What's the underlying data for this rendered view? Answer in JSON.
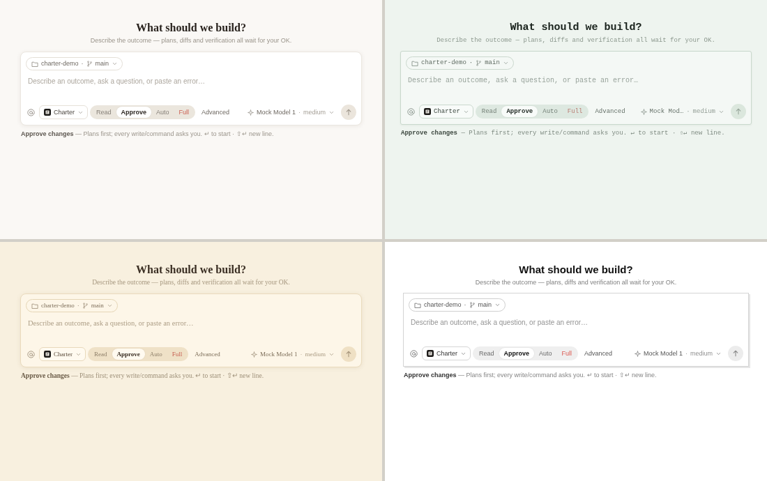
{
  "panels": [
    {
      "kind": "warm",
      "heading": "What should we build?",
      "subtitle": "Describe the outcome — plans, diffs and verification all wait for your OK.",
      "composer": {
        "repo": {
          "folder": "charter-demo",
          "separator": "·",
          "branch": "main"
        },
        "placeholder": "Describe an outcome, ask a question, or paste an error…",
        "agent": "Charter",
        "modes": [
          {
            "label": "Read",
            "selected": false,
            "kind": "normal"
          },
          {
            "label": "Approve",
            "selected": true,
            "kind": "normal"
          },
          {
            "label": "Auto",
            "selected": false,
            "kind": "normal"
          },
          {
            "label": "Full",
            "selected": false,
            "kind": "danger"
          }
        ],
        "advanced": "Advanced",
        "model": {
          "name": "Mock Model 1",
          "separator": "·",
          "effort": "medium"
        }
      },
      "hint": "**Approve changes** — Plans first; every write/command asks you. ↵ to start · ⇧↵ new line."
    },
    {
      "kind": "mint",
      "heading": "What should we build?",
      "subtitle": "Describe the outcome — plans, diffs and verification all wait for your OK.",
      "composer": {
        "repo": {
          "folder": "charter-demo",
          "separator": "·",
          "branch": "main"
        },
        "placeholder": "Describe an outcome, ask a question, or paste an error…",
        "agent": "Charter",
        "modes": [
          {
            "label": "Read",
            "selected": false,
            "kind": "normal"
          },
          {
            "label": "Approve",
            "selected": true,
            "kind": "normal"
          },
          {
            "label": "Auto",
            "selected": false,
            "kind": "normal"
          },
          {
            "label": "Full",
            "selected": false,
            "kind": "danger"
          }
        ],
        "advanced": "Advanced",
        "model": {
          "name": "Mock Mod…",
          "separator": "·",
          "effort": "medium"
        }
      },
      "hint": "**Approve changes** — Plans first; every write/command asks you. ↵ to start · ⇧↵ new line."
    },
    {
      "kind": "cream",
      "heading": "What should we build?",
      "subtitle": "Describe the outcome — plans, diffs and verification all wait for your OK.",
      "composer": {
        "repo": {
          "folder": "charter-demo",
          "separator": "·",
          "branch": "main"
        },
        "placeholder": "Describe an outcome, ask a question, or paste an error…",
        "agent": "Charter",
        "modes": [
          {
            "label": "Read",
            "selected": false,
            "kind": "normal"
          },
          {
            "label": "Approve",
            "selected": true,
            "kind": "normal"
          },
          {
            "label": "Auto",
            "selected": false,
            "kind": "normal"
          },
          {
            "label": "Full",
            "selected": false,
            "kind": "danger"
          }
        ],
        "advanced": "Advanced",
        "model": {
          "name": "Mock Model 1",
          "separator": "·",
          "effort": "medium"
        }
      },
      "hint": "**Approve changes** — Plans first; every write/command asks you. ↵ to start · ⇧↵ new line."
    },
    {
      "kind": "plain",
      "heading": "What should we build?",
      "subtitle": "Describe the outcome — plans, diffs and verification all wait for your OK.",
      "composer": {
        "repo": {
          "folder": "charter-demo",
          "separator": "·",
          "branch": "main"
        },
        "placeholder": "Describe an outcome, ask a question, or paste an error…",
        "agent": "Charter",
        "modes": [
          {
            "label": "Read",
            "selected": false,
            "kind": "normal"
          },
          {
            "label": "Approve",
            "selected": true,
            "kind": "normal"
          },
          {
            "label": "Auto",
            "selected": false,
            "kind": "normal"
          },
          {
            "label": "Full",
            "selected": false,
            "kind": "danger"
          }
        ],
        "advanced": "Advanced",
        "model": {
          "name": "Mock Model 1",
          "separator": "·",
          "effort": "medium"
        }
      },
      "hint": "**Approve changes** — Plans first; every write/command asks you. ↵ to start · ⇧↵ new line."
    }
  ]
}
